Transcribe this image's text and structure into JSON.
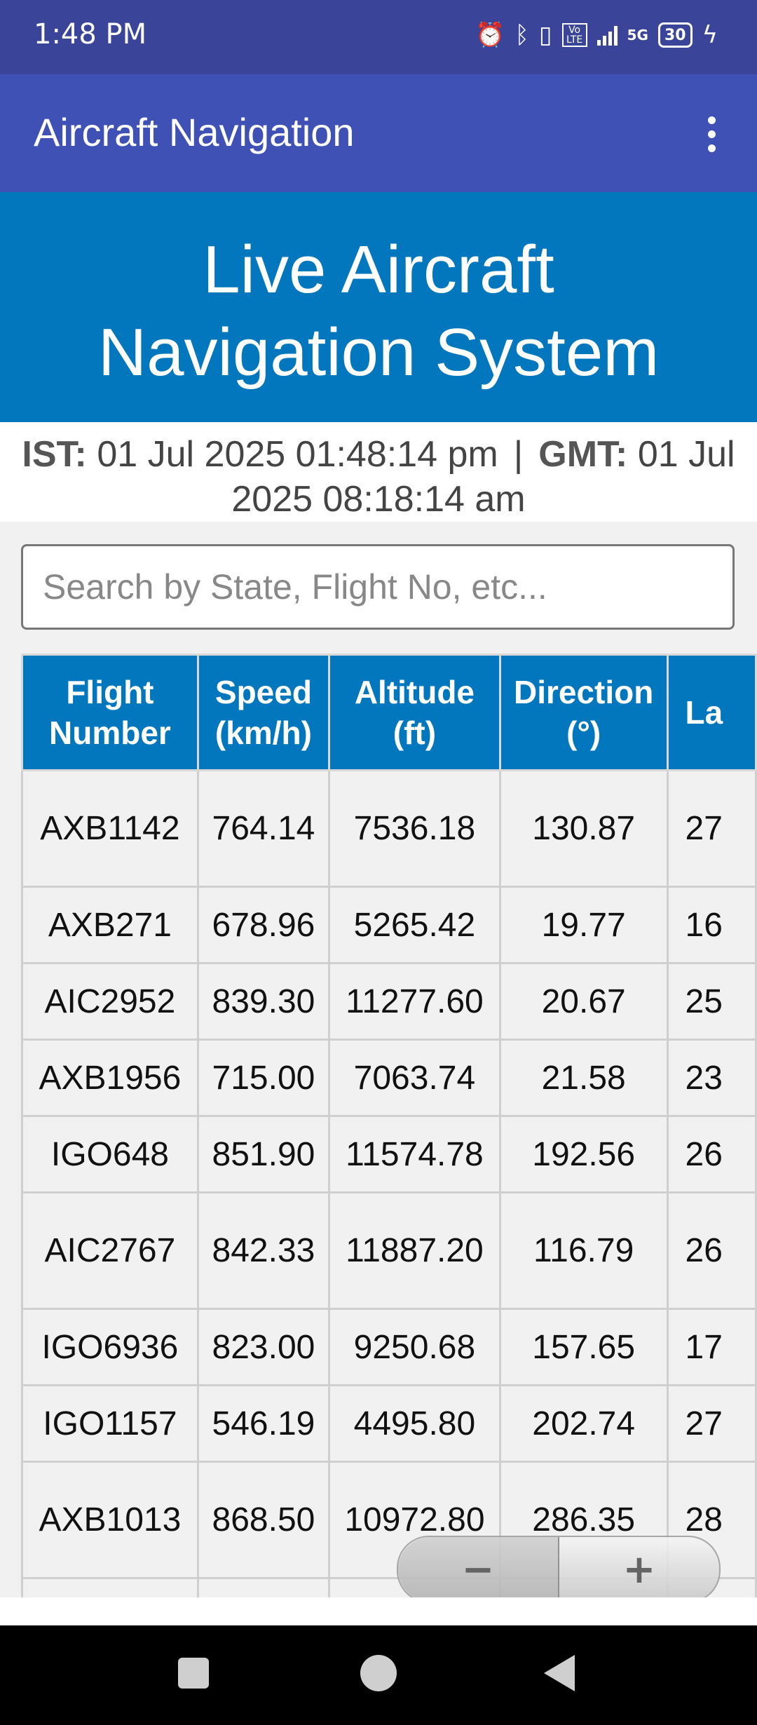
{
  "status_bar": {
    "time": "1:48 PM",
    "battery": "30",
    "network": "5G",
    "volte": "Vo LTE"
  },
  "app_bar": {
    "title": "Aircraft Navigation"
  },
  "header": {
    "line1": "Live Aircraft",
    "line2": "Navigation System"
  },
  "time_info": {
    "ist_label": "IST:",
    "ist_value": "01 Jul 2025 01:48:14 pm",
    "separator": "|",
    "gmt_label": "GMT:",
    "gmt_value": "01 Jul 2025 08:18:14 am"
  },
  "search": {
    "placeholder": "Search by State, Flight No, etc..."
  },
  "table": {
    "headers": [
      "Flight Number",
      "Speed (km/h)",
      "Altitude (ft)",
      "Direction (°)",
      "La"
    ],
    "rows": [
      [
        "AXB1142",
        "764.14",
        "7536.18",
        "130.87",
        "27"
      ],
      [
        "AXB271",
        "678.96",
        "5265.42",
        "19.77",
        "16"
      ],
      [
        "AIC2952",
        "839.30",
        "11277.60",
        "20.67",
        "25"
      ],
      [
        "AXB1956",
        "715.00",
        "7063.74",
        "21.58",
        "23"
      ],
      [
        "IGO648",
        "851.90",
        "11574.78",
        "192.56",
        "26"
      ],
      [
        "AIC2767",
        "842.33",
        "11887.20",
        "116.79",
        "26"
      ],
      [
        "IGO6936",
        "823.00",
        "9250.68",
        "157.65",
        "17"
      ],
      [
        "IGO1157",
        "546.19",
        "4495.80",
        "202.74",
        "27"
      ],
      [
        "AXB1013",
        "868.50",
        "10972.80",
        "286.35",
        "28"
      ]
    ]
  },
  "zoom": {
    "out": "−",
    "in": "+"
  }
}
